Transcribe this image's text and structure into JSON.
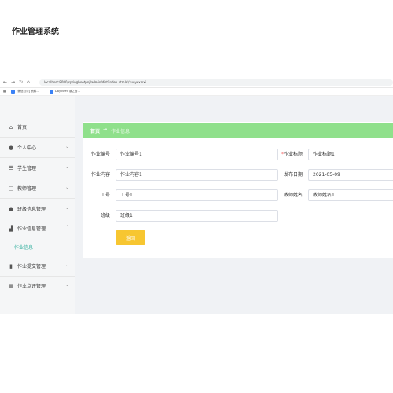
{
  "browser": {
    "url": "localhost:8080/springbootpnj/admin/dist/index.html#/zuoyexinxi",
    "bookmarks": [
      "[微信公众] 资料…",
      "DayIN 99 读之台…"
    ]
  },
  "app": {
    "title": "作业管理系统"
  },
  "sidebar": {
    "items": [
      {
        "label": "首页",
        "icon": "home-icon",
        "glyph": "⌂",
        "caret": ""
      },
      {
        "label": "个人中心",
        "icon": "user-icon",
        "glyph": "●",
        "caret": "⌄"
      },
      {
        "label": "学生管理",
        "icon": "list-icon",
        "glyph": "☰",
        "caret": "⌄"
      },
      {
        "label": "教师管理",
        "icon": "chat-icon",
        "glyph": "▢",
        "caret": "⌄"
      },
      {
        "label": "班级信息管理",
        "icon": "user-icon",
        "glyph": "●",
        "caret": "⌄"
      },
      {
        "label": "作业信息管理",
        "icon": "stats-icon",
        "glyph": "▟",
        "caret": "⌃"
      },
      {
        "label": "作业提交管理",
        "icon": "bar-chart-icon",
        "glyph": "▮",
        "caret": "⌄"
      },
      {
        "label": "作业点评管理",
        "icon": "grid-icon",
        "glyph": "▦",
        "caret": "⌄"
      }
    ],
    "submenu": {
      "label": "作业信息"
    }
  },
  "breadcrumb": {
    "home": "首页",
    "separator": "→",
    "current": "作业信息"
  },
  "form": {
    "homework_no": {
      "label": "作业编号",
      "value": "作业编号1"
    },
    "homework_title": {
      "required": "*",
      "label": "作业标题",
      "value": "作业标题1"
    },
    "homework_content": {
      "label": "作业内容",
      "value": "作业内容1"
    },
    "publish_date": {
      "label": "发布日期",
      "value": "2021-05-09"
    },
    "staff_no": {
      "label": "工号",
      "value": "工号1"
    },
    "teacher_name": {
      "label": "教师姓名",
      "value": "教师姓名1"
    },
    "class_name": {
      "label": "班级",
      "value": "班级1"
    },
    "back_button": "返回"
  },
  "colors": {
    "accent": "#8fe08b",
    "button": "#f7c631",
    "active_text": "#3bb3a2"
  }
}
